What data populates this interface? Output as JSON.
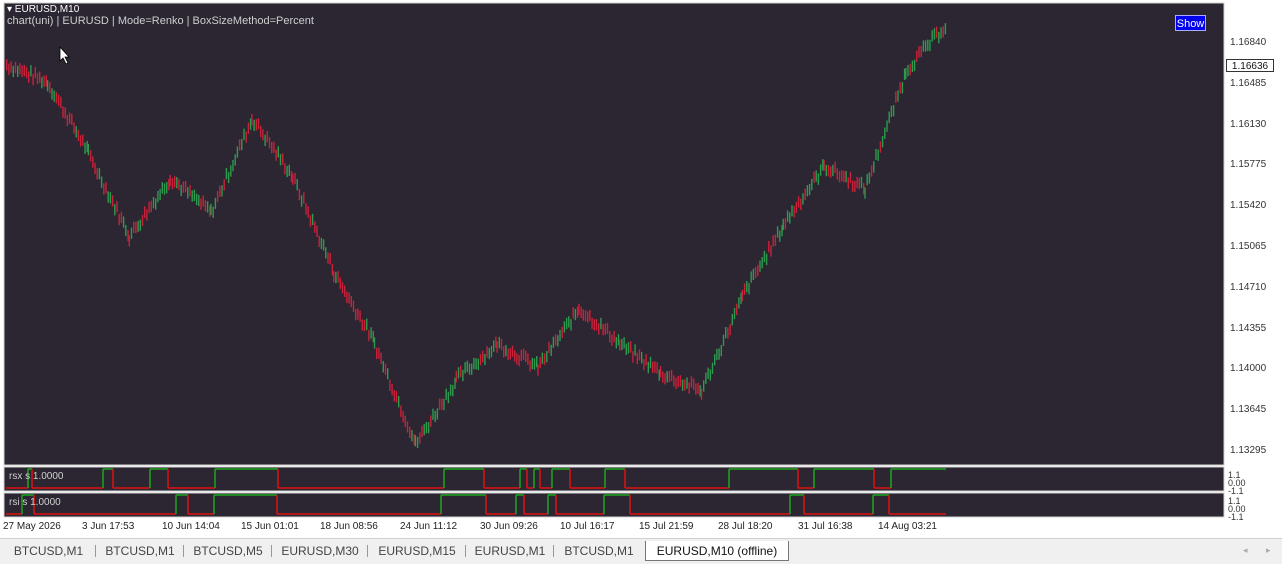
{
  "header": {
    "symbol_title": "▾ EURUSD,M10",
    "chart_info": "chart(uni)  |  EURUSD  |  Mode=Renko  |  BoxSizeMethod=Percent",
    "show_button": "Show"
  },
  "price_axis": {
    "labels": [
      "1.16840",
      "1.16485",
      "1.16130",
      "1.15775",
      "1.15420",
      "1.15065",
      "1.14710",
      "1.14355",
      "1.14000",
      "1.13645",
      "1.13295"
    ],
    "current_price": "1.16636"
  },
  "time_axis": {
    "labels": [
      "27 May 2026",
      "3 Jun 17:53",
      "10 Jun 14:04",
      "15 Jun 01:01",
      "18 Jun 08:56",
      "24 Jun 11:12",
      "30 Jun 09:26",
      "10 Jul 16:17",
      "15 Jul 21:59",
      "28 Jul 18:20",
      "31 Jul 16:38",
      "14 Aug 03:21"
    ]
  },
  "subwindows": [
    {
      "label": "rsx s  1.0000",
      "scale": [
        "1.1",
        "0.00",
        "-1.1"
      ]
    },
    {
      "label": "rsi s  1.0000",
      "scale": [
        "1.1",
        "0.00",
        "-1.1"
      ]
    }
  ],
  "colors": {
    "background": "#2b2631",
    "up_brick": "#2e9a4e",
    "down_brick": "#c8213a",
    "signal_up": "#1fa51f",
    "signal_down": "#e01010"
  },
  "chart_data": {
    "type": "line",
    "chart_kind": "renko",
    "symbol": "EURUSD",
    "timeframe": "M10",
    "ylim": [
      1.132,
      1.1705
    ],
    "y_ticks": [
      1.1684,
      1.16485,
      1.1613,
      1.15775,
      1.1542,
      1.15065,
      1.1471,
      1.14355,
      1.14,
      1.13645,
      1.13295
    ],
    "last_price": 1.16636,
    "x": [
      "27 May 2026",
      "3 Jun 17:53",
      "10 Jun 14:04",
      "15 Jun 01:01",
      "18 Jun 08:56",
      "24 Jun 11:12",
      "30 Jun 09:26",
      "10 Jul 16:17",
      "15 Jul 21:59",
      "28 Jul 18:20",
      "31 Jul 16:38",
      "14 Aug 03:21"
    ],
    "series": [
      {
        "values": [
          1.1655,
          1.164,
          1.158,
          1.151,
          1.156,
          1.153,
          1.161,
          1.156,
          1.148,
          1.142,
          1.1335,
          1.139,
          1.142,
          1.14,
          1.145,
          1.142,
          1.1395,
          1.138,
          1.146,
          1.152,
          1.157,
          1.155,
          1.165,
          1.169
        ]
      }
    ]
  },
  "tabs": [
    {
      "label": "BTCUSD,M1"
    },
    {
      "label": "BTCUSD,M1"
    },
    {
      "label": "BTCUSD,M5"
    },
    {
      "label": "EURUSD,M30"
    },
    {
      "label": "EURUSD,M15"
    },
    {
      "label": "EURUSD,M1"
    },
    {
      "label": "BTCUSD,M1"
    },
    {
      "label": "EURUSD,M10 (offline)"
    }
  ],
  "tab_scroll": {
    "left": "◂",
    "right": "▸"
  }
}
